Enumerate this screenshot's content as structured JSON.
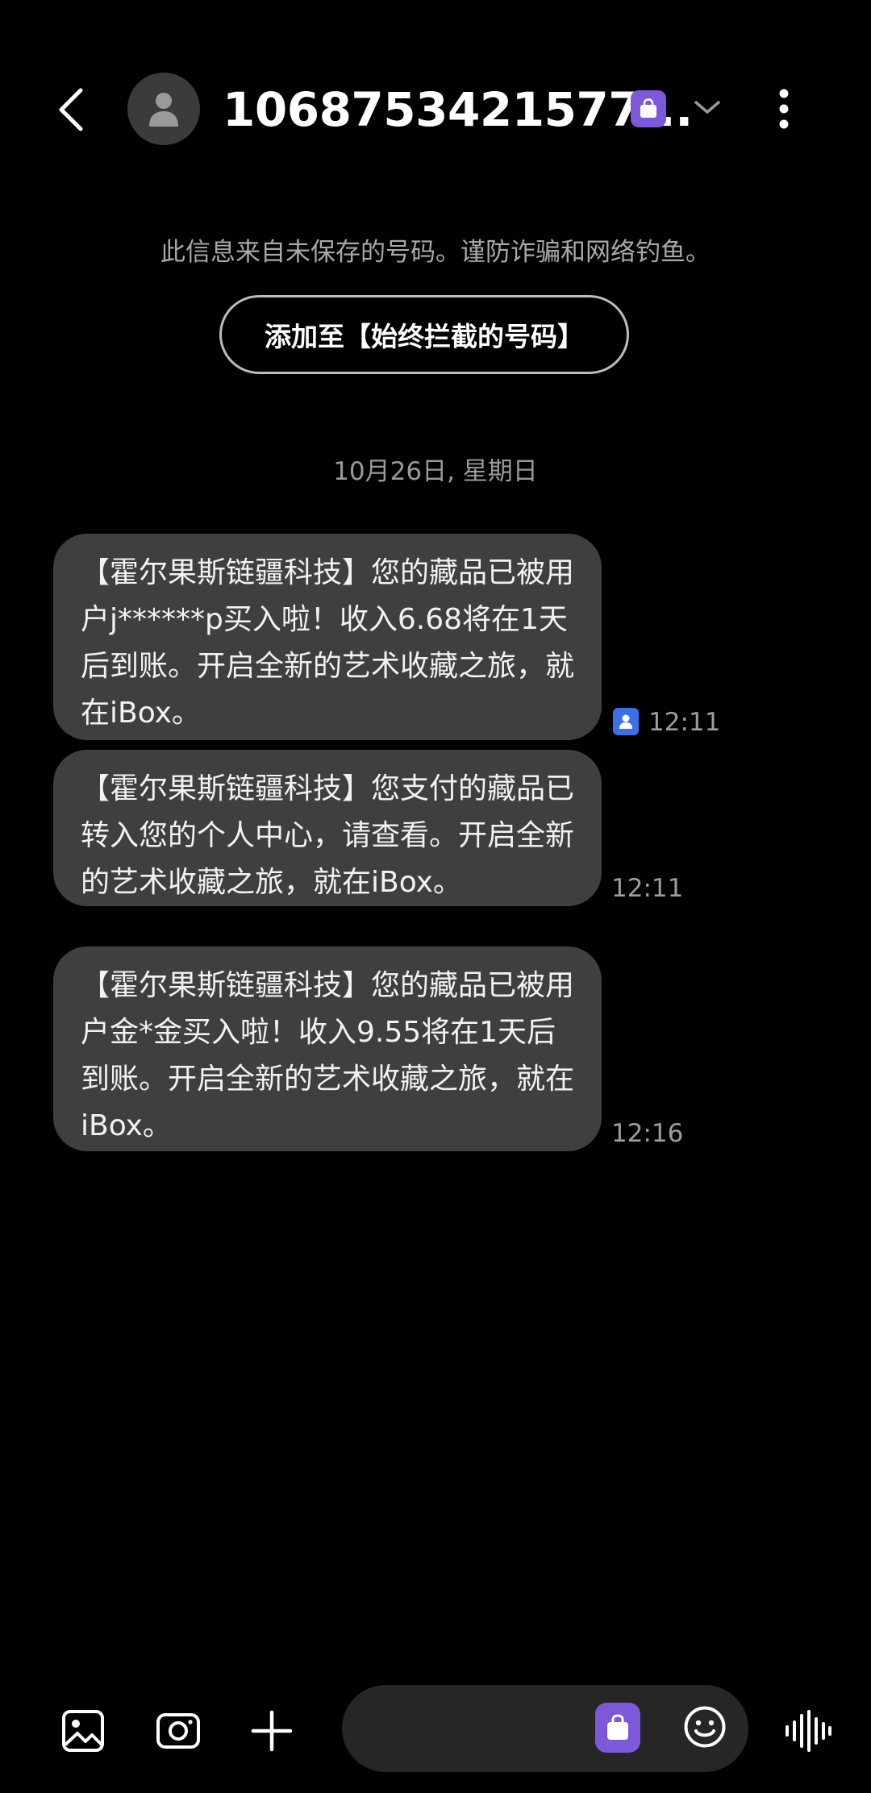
{
  "header": {
    "contact_title": "1068753421577...",
    "back_icon": "chevron-left-icon",
    "avatar_icon": "person-icon",
    "badge_icon": "shopping-bag-icon",
    "badge_color": "#7d58d8",
    "dropdown_icon": "chevron-down-icon",
    "more_icon": "more-vertical-icon"
  },
  "warning": {
    "text": "此信息来自未保存的号码。谨防诈骗和网络钓鱼。",
    "block_button_label": "添加至【始终拦截的号码】"
  },
  "date_divider": "10月26日, 星期日",
  "messages": [
    {
      "text": "【霍尔果斯链疆科技】您的藏品已被用户j******p买入啦！收入6.68将在1天后到账。开启全新的艺术收藏之旅，就在iBox。",
      "time": "12:11",
      "has_contact_chip": true
    },
    {
      "text": "【霍尔果斯链疆科技】您支付的藏品已转入您的个人中心，请查看。开启全新的艺术收藏之旅，就在iBox。",
      "time": "12:11",
      "has_contact_chip": false
    },
    {
      "text": "【霍尔果斯链疆科技】您的藏品已被用户金*金买入啦！收入9.55将在1天后到账。开启全新的艺术收藏之旅，就在iBox。",
      "time": "12:16",
      "has_contact_chip": false
    }
  ],
  "bottom_bar": {
    "gallery_icon": "image-icon",
    "camera_icon": "camera-icon",
    "add_icon": "plus-icon",
    "input_placeholder": "",
    "input_value": "",
    "badge_icon": "shopping-bag-icon",
    "emoji_icon": "smiley-icon",
    "voice_icon": "sound-wave-icon"
  },
  "colors": {
    "background": "#000000",
    "bubble": "#3f3f3f",
    "accent_purple": "#7d58d8",
    "contact_chip_blue": "#3a6fe6",
    "secondary_text": "#9d9d9d"
  }
}
